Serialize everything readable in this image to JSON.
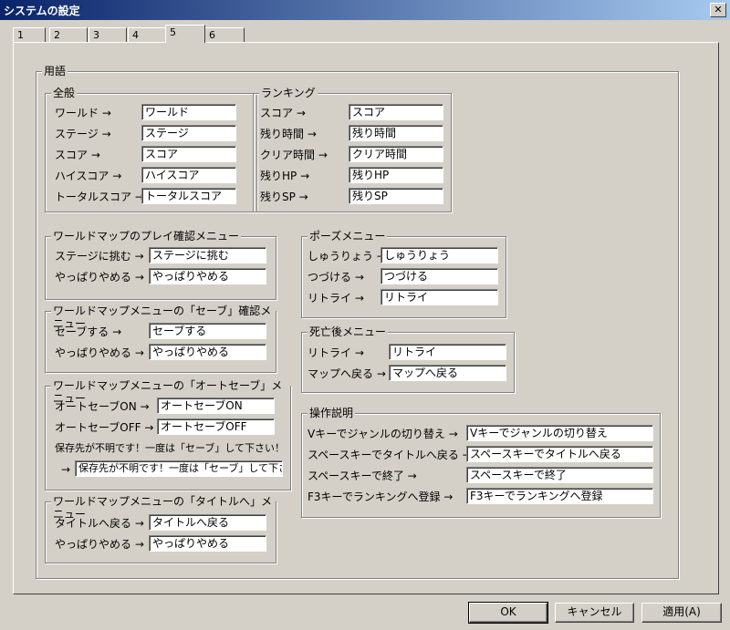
{
  "window": {
    "title": "システムの設定",
    "close": "✕"
  },
  "tabs": [
    "1",
    "2",
    "3",
    "4",
    "5",
    "6"
  ],
  "main_group": "用語",
  "groups": {
    "general": {
      "title": "全般",
      "rows": [
        {
          "label": "ワールド →",
          "value": "ワールド"
        },
        {
          "label": "ステージ →",
          "value": "ステージ"
        },
        {
          "label": "スコア →",
          "value": "スコア"
        },
        {
          "label": "ハイスコア →",
          "value": "ハイスコア"
        },
        {
          "label": "トータルスコア →",
          "value": "トータルスコア"
        }
      ]
    },
    "ranking": {
      "title": "ランキング",
      "rows": [
        {
          "label": "スコア →",
          "value": "スコア"
        },
        {
          "label": "残り時間 →",
          "value": "残り時間"
        },
        {
          "label": "クリア時間 →",
          "value": "クリア時間"
        },
        {
          "label": "残りHP →",
          "value": "残りHP"
        },
        {
          "label": "残りSP →",
          "value": "残りSP"
        }
      ]
    },
    "play_confirm": {
      "title": "ワールドマップのプレイ確認メニュー",
      "rows": [
        {
          "label": "ステージに挑む →",
          "value": "ステージに挑む"
        },
        {
          "label": "やっぱりやめる →",
          "value": "やっぱりやめる"
        }
      ]
    },
    "pause": {
      "title": "ポーズメニュー",
      "rows": [
        {
          "label": "しゅうりょう →",
          "value": "しゅうりょう"
        },
        {
          "label": "つづける →",
          "value": "つづける"
        },
        {
          "label": "リトライ →",
          "value": "リトライ"
        }
      ]
    },
    "save_confirm": {
      "title": "ワールドマップメニューの「セーブ」確認メニュー",
      "rows": [
        {
          "label": "セーブする →",
          "value": "セーブする"
        },
        {
          "label": "やっぱりやめる →",
          "value": "やっぱりやめる"
        }
      ]
    },
    "after_death": {
      "title": "死亡後メニュー",
      "rows": [
        {
          "label": "リトライ →",
          "value": "リトライ"
        },
        {
          "label": "マップへ戻る →",
          "value": "マップへ戻る"
        }
      ]
    },
    "autosave": {
      "title": "ワールドマップメニューの「オートセーブ」メニュー",
      "rows": [
        {
          "label": "オートセーブON →",
          "value": "オートセーブON"
        },
        {
          "label": "オートセーブOFF →",
          "value": "オートセーブOFF"
        }
      ],
      "note": "保存先が不明です！一度は「セーブ」して下さい！",
      "note_arrow": "→",
      "note_value": "保存先が不明です！一度は「セーブ」して下さい！"
    },
    "controls": {
      "title": "操作説明",
      "rows": [
        {
          "label": "Vキーでジャンルの切り替え →",
          "value": "Vキーでジャンルの切り替え"
        },
        {
          "label": "スペースキーでタイトルへ戻る →",
          "value": "スペースキーでタイトルへ戻る"
        },
        {
          "label": "スペースキーで終了 →",
          "value": "スペースキーで終了"
        },
        {
          "label": "F3キーでランキングへ登録 →",
          "value": "F3キーでランキングへ登録"
        }
      ]
    },
    "to_title": {
      "title": "ワールドマップメニューの「タイトルへ」メニュー",
      "rows": [
        {
          "label": "タイトルへ戻る →",
          "value": "タイトルへ戻る"
        },
        {
          "label": "やっぱりやめる →",
          "value": "やっぱりやめる"
        }
      ]
    }
  },
  "buttons": {
    "ok": "OK",
    "cancel": "キャンセル",
    "apply": "適用(A)"
  }
}
